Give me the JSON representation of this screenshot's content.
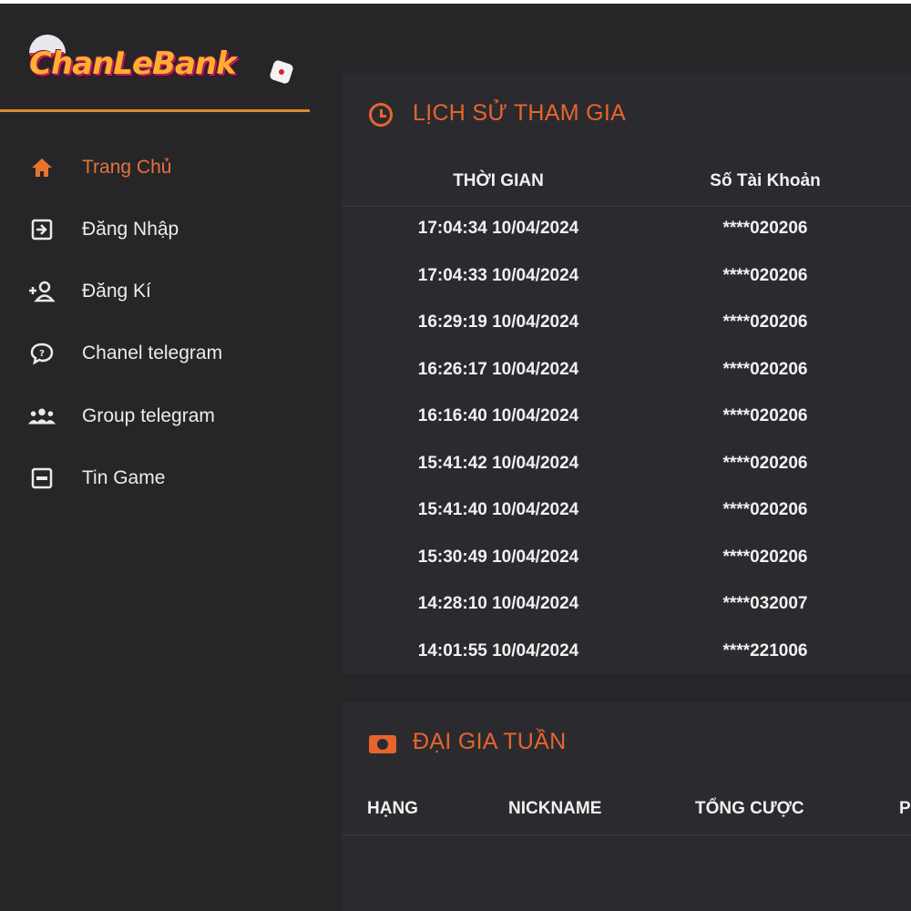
{
  "brand": {
    "logo_text": "ChanLeBank"
  },
  "sidebar": {
    "items": [
      {
        "label": "Trang Chủ",
        "icon": "home-icon",
        "active": true
      },
      {
        "label": "Đăng Nhập",
        "icon": "login-icon",
        "active": false
      },
      {
        "label": "Đăng Kí",
        "icon": "add-user-icon",
        "active": false
      },
      {
        "label": "Chanel telegram",
        "icon": "chat-icon",
        "active": false
      },
      {
        "label": "Group telegram",
        "icon": "group-icon",
        "active": false
      },
      {
        "label": "Tin Game",
        "icon": "news-icon",
        "active": false
      }
    ]
  },
  "history": {
    "title": "LỊCH SỬ THAM GIA",
    "columns": [
      "THỜI GIAN",
      "Số Tài Khoản"
    ],
    "rows": [
      {
        "time": "17:04:34 10/04/2024",
        "account": "****020206"
      },
      {
        "time": "17:04:33 10/04/2024",
        "account": "****020206"
      },
      {
        "time": "16:29:19 10/04/2024",
        "account": "****020206"
      },
      {
        "time": "16:26:17 10/04/2024",
        "account": "****020206"
      },
      {
        "time": "16:16:40 10/04/2024",
        "account": "****020206"
      },
      {
        "time": "15:41:42 10/04/2024",
        "account": "****020206"
      },
      {
        "time": "15:41:40 10/04/2024",
        "account": "****020206"
      },
      {
        "time": "15:30:49 10/04/2024",
        "account": "****020206"
      },
      {
        "time": "14:28:10 10/04/2024",
        "account": "****032007"
      },
      {
        "time": "14:01:55 10/04/2024",
        "account": "****221006"
      }
    ]
  },
  "leaderboard": {
    "title": "ĐẠI GIA TUẦN",
    "columns": [
      "HẠNG",
      "NICKNAME",
      "TỔNG CƯỢC",
      "P"
    ]
  },
  "colors": {
    "accent": "#e8642c",
    "background": "#262629",
    "panel": "#2b2b2f",
    "divider": "#d98a2b"
  }
}
